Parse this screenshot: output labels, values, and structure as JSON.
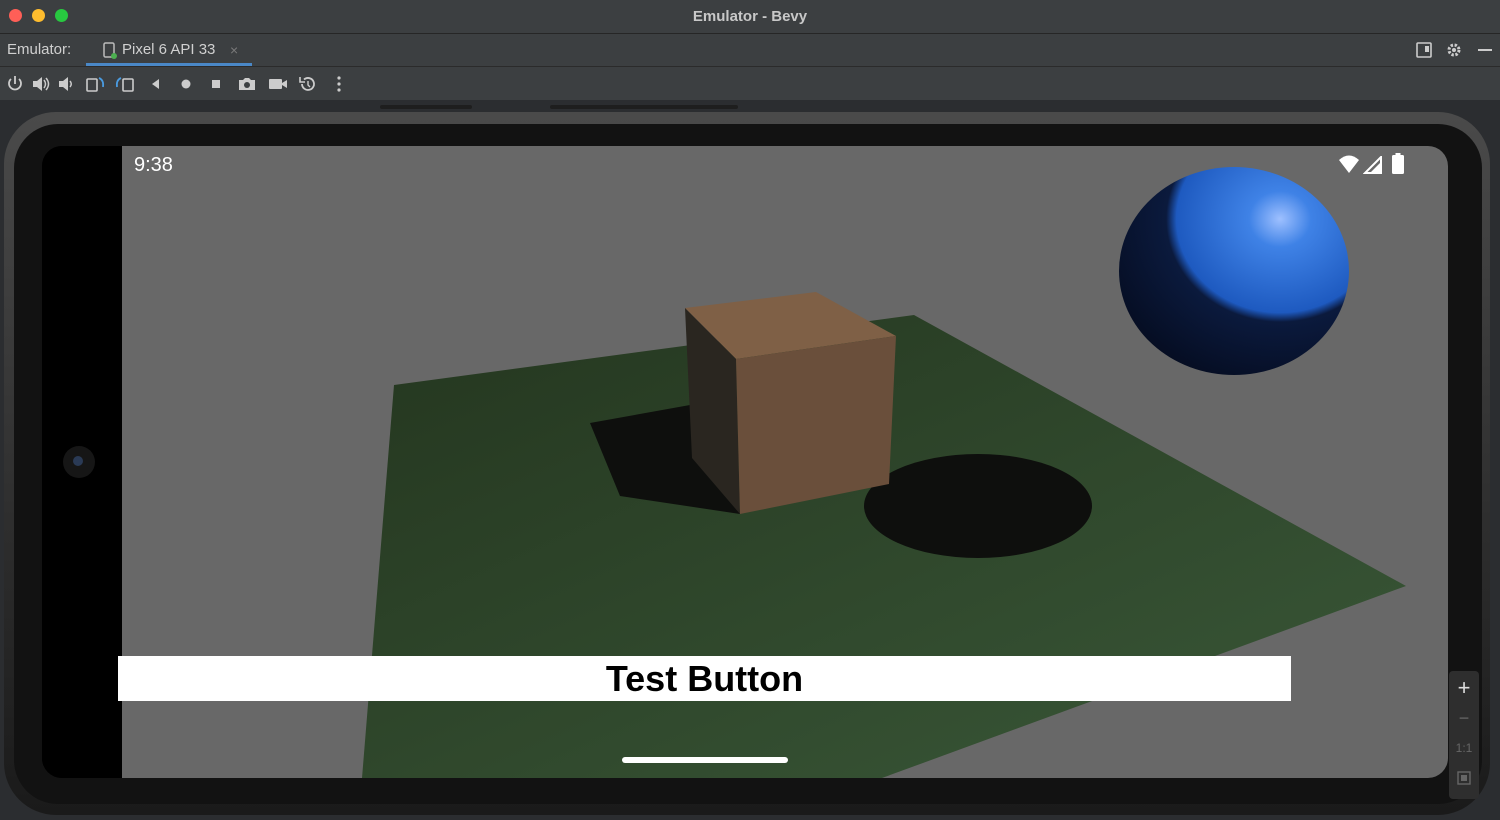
{
  "window": {
    "title": "Emulator - Bevy"
  },
  "tabbar": {
    "emulator_label": "Emulator:",
    "active_tab": "Pixel 6 API 33",
    "close_glyph": "×"
  },
  "toolbar": {
    "icons": [
      "power-icon",
      "volume-up-icon",
      "volume-down-icon",
      "rotate-left-icon",
      "rotate-right-icon",
      "back-icon",
      "home-icon",
      "overview-icon",
      "screenshot-icon",
      "screen-record-icon",
      "snapshot-icon",
      "more-options-icon"
    ]
  },
  "device": {
    "status_time": "9:38",
    "button_label": "Test Button"
  },
  "zoom": {
    "plus": "+",
    "minus": "−",
    "one_to_one": "1:1"
  },
  "colors": {
    "window_chrome": "#3c3f41",
    "accent_tab": "#4a88c7",
    "scene_background": "#686868",
    "ground": "#2d4a2d",
    "cube": "#7a5c43",
    "sphere": "#2e6fd1"
  }
}
